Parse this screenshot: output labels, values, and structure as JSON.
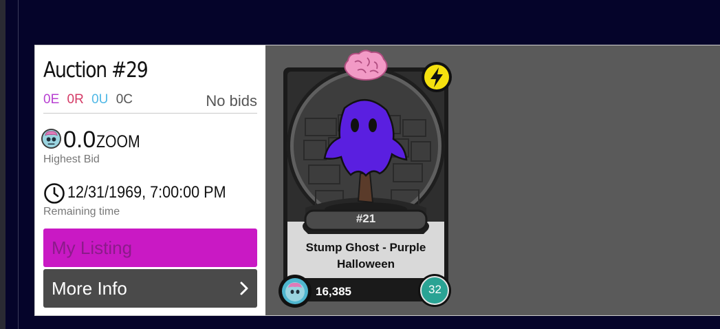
{
  "auction": {
    "title": "Auction #29",
    "tags": [
      {
        "label": "0E",
        "color": "#b73fd1"
      },
      {
        "label": "0R",
        "color": "#d43a66"
      },
      {
        "label": "0U",
        "color": "#4fb8e6"
      },
      {
        "label": "0C",
        "color": "#555555"
      }
    ],
    "bid_status": "No bids",
    "highest_bid": {
      "value": "0.0",
      "unit": "ZOOM",
      "caption": "Highest Bid",
      "icon": "zombie-token-icon"
    },
    "remaining": {
      "value": "12/31/1969, 7:00:00 PM",
      "caption": "Remaining time",
      "icon": "clock-icon"
    },
    "buttons": {
      "my_listing": "My Listing",
      "more_info": "More Info"
    }
  },
  "card": {
    "serial": "#21",
    "name_line1": "Stump Ghost - Purple",
    "name_line2": "Halloween",
    "count": "16,385",
    "level": "32",
    "icons": {
      "top": "brain-icon",
      "badge": "lightning-icon",
      "corner": "zombie-token-icon"
    }
  },
  "colors": {
    "page_bg": "#05042a",
    "panel_bg": "#5a5a5a",
    "listing_button": "#c919c4",
    "more_info_button": "#4a4a4a",
    "ghost": "#5a1fe0",
    "level_badge": "#2aa394",
    "lightning_badge": "#f5e10f"
  }
}
